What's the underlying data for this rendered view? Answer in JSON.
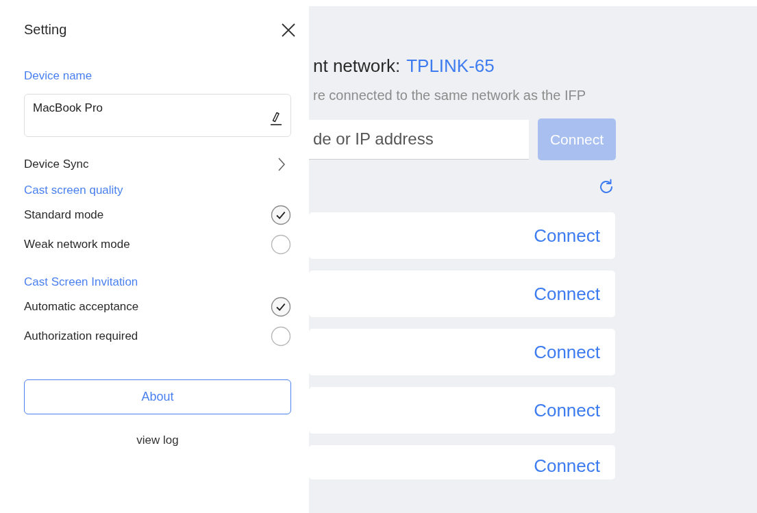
{
  "settings_panel": {
    "title": "Setting",
    "device_name": {
      "label": "Device name",
      "value": "MacBook Pro"
    },
    "device_sync": {
      "label": "Device Sync"
    },
    "groups": [
      {
        "label": "Cast screen quality",
        "options": [
          {
            "label": "Standard mode",
            "selected": true
          },
          {
            "label": "Weak network mode",
            "selected": false
          }
        ]
      },
      {
        "label": "Cast Screen Invitation",
        "options": [
          {
            "label": "Automatic acceptance",
            "selected": true
          },
          {
            "label": "Authorization required",
            "selected": false
          }
        ]
      }
    ],
    "about_button": "About",
    "view_log_link": "view log"
  },
  "main": {
    "network_label": "nt network:",
    "network_name": "TPLINK-65",
    "hint": "re connected to the same network as the IFP",
    "address_field": {
      "placeholder": "de or IP address"
    },
    "connect_button": {
      "label": "Connect",
      "disabled": true
    },
    "devices": [
      {
        "button": "Connect"
      },
      {
        "button": "Connect"
      },
      {
        "button": "Connect"
      },
      {
        "button": "Connect"
      },
      {
        "button": "Connect"
      }
    ]
  }
}
